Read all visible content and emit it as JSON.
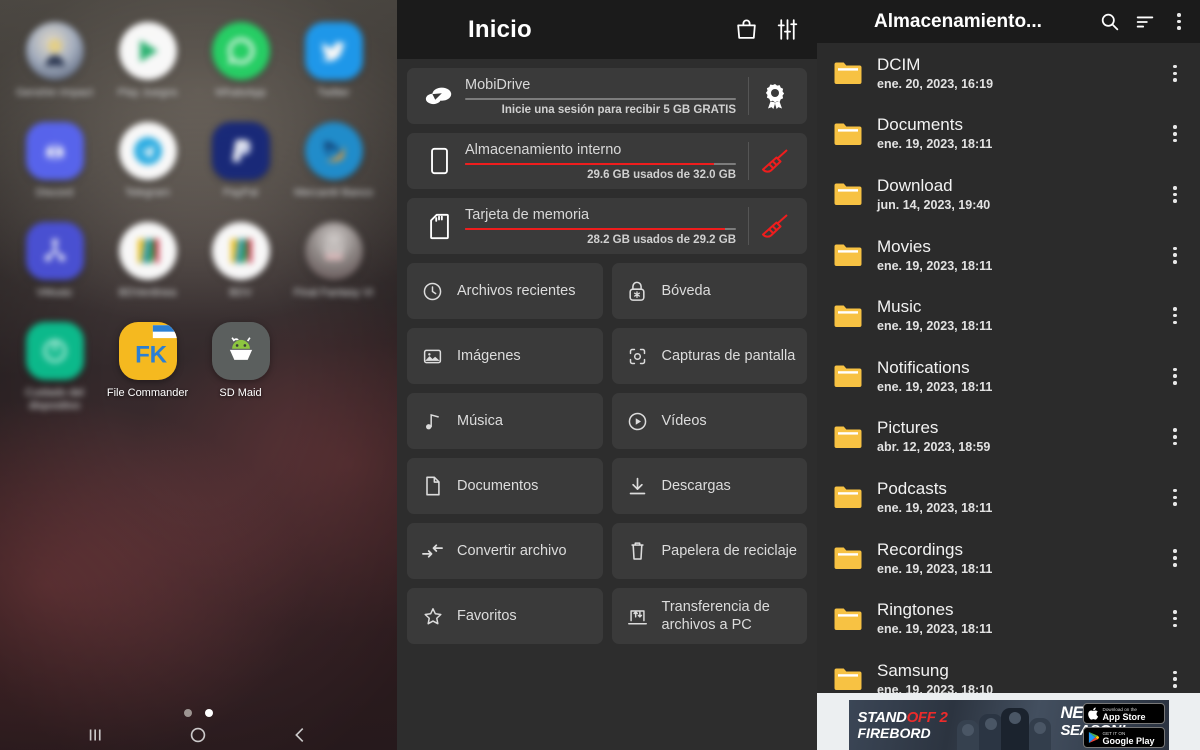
{
  "home": {
    "apps": [
      {
        "label": "Genshin Impact",
        "icon": "genshin-icon",
        "blurred": true
      },
      {
        "label": "Play Juegos",
        "icon": "play-games-icon",
        "blurred": true
      },
      {
        "label": "WhatsApp",
        "icon": "whatsapp-icon",
        "blurred": true
      },
      {
        "label": "Twitter",
        "icon": "twitter-icon",
        "blurred": true
      },
      {
        "label": "Discord",
        "icon": "discord-icon",
        "blurred": true
      },
      {
        "label": "Telegram",
        "icon": "telegram-icon",
        "blurred": true
      },
      {
        "label": "PayPal",
        "icon": "paypal-icon",
        "blurred": true
      },
      {
        "label": "Mercantil Banco",
        "icon": "mercantil-icon",
        "blurred": true
      },
      {
        "label": "VMusic",
        "icon": "vmusic-icon",
        "blurred": true
      },
      {
        "label": "BDVenlinea",
        "icon": "bdv-linea-icon",
        "blurred": true
      },
      {
        "label": "BDV",
        "icon": "bdv-icon",
        "blurred": true
      },
      {
        "label": "Final Fantasy VI",
        "icon": "final-fantasy-icon",
        "blurred": true
      },
      {
        "label": "Cuidado del dispositivo",
        "icon": "device-care-icon",
        "blurred": true
      },
      {
        "label": "File Commander",
        "icon": "file-commander-icon",
        "blurred": false
      },
      {
        "label": "SD Maid",
        "icon": "sd-maid-icon",
        "blurred": false
      }
    ],
    "page_dots": {
      "count": 2,
      "active_index": 1
    }
  },
  "file_commander": {
    "appbar": {
      "title": "Inicio",
      "menu_icon": "hamburger-menu-icon",
      "shop_icon": "shopping-bag-icon",
      "tune_icon": "tune-sliders-icon"
    },
    "storage": [
      {
        "name": "MobiDrive",
        "subtitle": "Inicie una sesión para recibir 5 GB GRATIS",
        "lead_icon": "cloud-drive-icon",
        "action_icon": "award-ribbon-icon",
        "progress_percent": 0,
        "bar_color": "#7c7c7c"
      },
      {
        "name": "Almacenamiento interno",
        "subtitle": "29.6 GB usados de 32.0 GB",
        "lead_icon": "phone-icon",
        "action_icon": "broom-clean-icon",
        "progress_percent": 92,
        "bar_color": "#ef1d1d"
      },
      {
        "name": "Tarjeta de memoria",
        "subtitle": "28.2 GB usados de 29.2 GB",
        "lead_icon": "sd-card-icon",
        "action_icon": "broom-clean-icon",
        "progress_percent": 96,
        "bar_color": "#ef1d1d"
      }
    ],
    "tiles": [
      {
        "label": "Archivos recientes",
        "icon": "clock-icon"
      },
      {
        "label": "Bóveda",
        "icon": "lock-vault-icon"
      },
      {
        "label": "Imágenes",
        "icon": "image-icon"
      },
      {
        "label": "Capturas de pantalla",
        "icon": "screenshot-icon"
      },
      {
        "label": "Música",
        "icon": "music-note-icon"
      },
      {
        "label": "Vídeos",
        "icon": "play-circle-icon"
      },
      {
        "label": "Documentos",
        "icon": "document-icon"
      },
      {
        "label": "Descargas",
        "icon": "download-icon"
      },
      {
        "label": "Convertir archivo",
        "icon": "convert-arrows-icon"
      },
      {
        "label": "Papelera de reciclaje",
        "icon": "trash-icon"
      },
      {
        "label": "Favoritos",
        "icon": "star-icon"
      },
      {
        "label": "Transferencia de archivos a PC",
        "icon": "pc-transfer-icon"
      }
    ]
  },
  "browser": {
    "appbar": {
      "title": "Almacenamiento...",
      "menu_icon": "hamburger-menu-icon",
      "search_icon": "search-icon",
      "sort_icon": "sort-icon",
      "overflow_icon": "kebab-menu-icon"
    },
    "folder_color": "#f7c243",
    "rows": [
      {
        "name": "DCIM",
        "date": "ene. 20, 2023, 16:19"
      },
      {
        "name": "Documents",
        "date": "ene. 19, 2023, 18:11"
      },
      {
        "name": "Download",
        "date": "jun. 14, 2023, 19:40"
      },
      {
        "name": "Movies",
        "date": "ene. 19, 2023, 18:11"
      },
      {
        "name": "Music",
        "date": "ene. 19, 2023, 18:11"
      },
      {
        "name": "Notifications",
        "date": "ene. 19, 2023, 18:11"
      },
      {
        "name": "Pictures",
        "date": "abr. 12, 2023, 18:59"
      },
      {
        "name": "Podcasts",
        "date": "ene. 19, 2023, 18:11"
      },
      {
        "name": "Recordings",
        "date": "ene. 19, 2023, 18:11"
      },
      {
        "name": "Ringtones",
        "date": "ene. 19, 2023, 18:11"
      },
      {
        "name": "Samsung",
        "date": "ene. 19, 2023, 18:10"
      }
    ],
    "ad": {
      "brand_stand": "STAND",
      "brand_off": "OFF 2",
      "brand_line2": "FIREBORD",
      "headline_1": "NEW",
      "headline_2": "SEASON!",
      "store_apple_small": "Download on the",
      "store_apple_big": "App Store",
      "store_google_small": "GET IT ON",
      "store_google_big": "Google Play"
    }
  },
  "colors": {
    "appbar_bg": "#1b1b1b",
    "fc_bg": "#2d2d2d",
    "card_bg": "#3a3a3a",
    "browser_bg": "#2b2b2b",
    "accent_red": "#ef1d1d",
    "folder_amber": "#f7c243",
    "ad_bg": "#eceff1"
  }
}
